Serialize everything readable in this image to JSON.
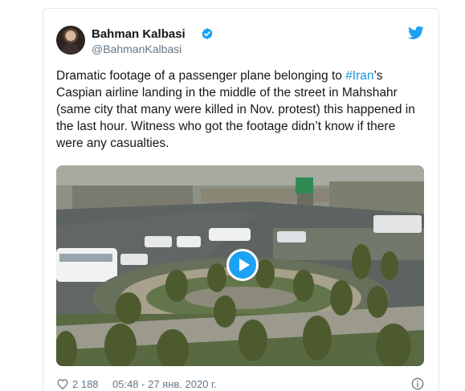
{
  "author": {
    "name": "Bahman Kalbasi",
    "handle": "@BahmanKalbasi",
    "verified": true
  },
  "tweet": {
    "text_before_hashtag": "Dramatic footage of a passenger plane belonging to ",
    "hashtag": "#Iran",
    "text_after_hashtag": "’s Caspian airline landing in the middle of the street in Mahshahr (same city that many were killed in Nov. protest) this happened in the last hour. Witness who got the footage didn’t know if there were any casualties."
  },
  "media": {
    "type": "video"
  },
  "footer": {
    "likes": "2 188",
    "timestamp": "05:48 - 27 янв. 2020 г."
  },
  "icons": {
    "bird": "twitter-bird-icon",
    "verified": "verified-badge-icon",
    "like": "heart-icon",
    "info": "info-icon",
    "play": "play-icon"
  },
  "colors": {
    "twitter_blue": "#1da1f2",
    "link": "#1b95e0",
    "muted": "#657786"
  }
}
